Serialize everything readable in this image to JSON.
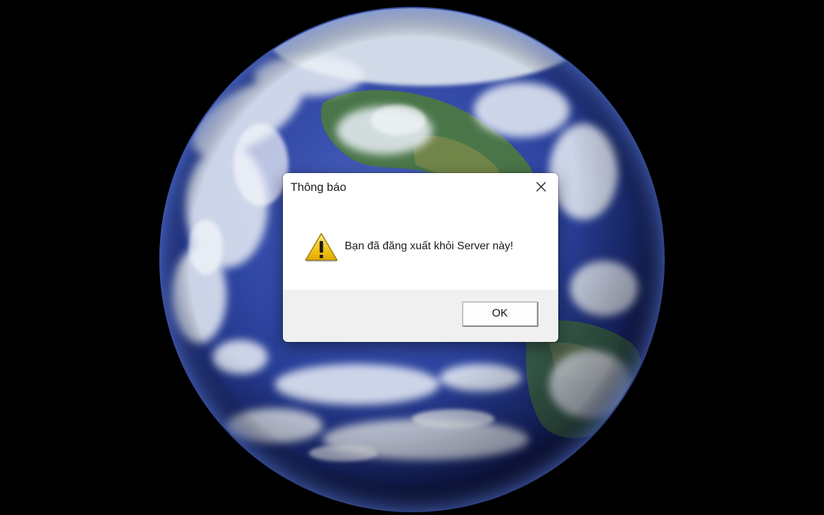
{
  "dialog": {
    "title": "Thông báo",
    "message": "Bạn đã đăng xuất khỏi Server này!",
    "ok_label": "OK",
    "icons": {
      "warning": "warning-icon",
      "close": "close-icon"
    }
  },
  "desktop": {
    "wallpaper": "earth-globe",
    "background_color": "#000000",
    "ocean_color": "#2a3f9a",
    "land_color": "#3e6b3a",
    "cloud_color": "#e8eef5"
  }
}
